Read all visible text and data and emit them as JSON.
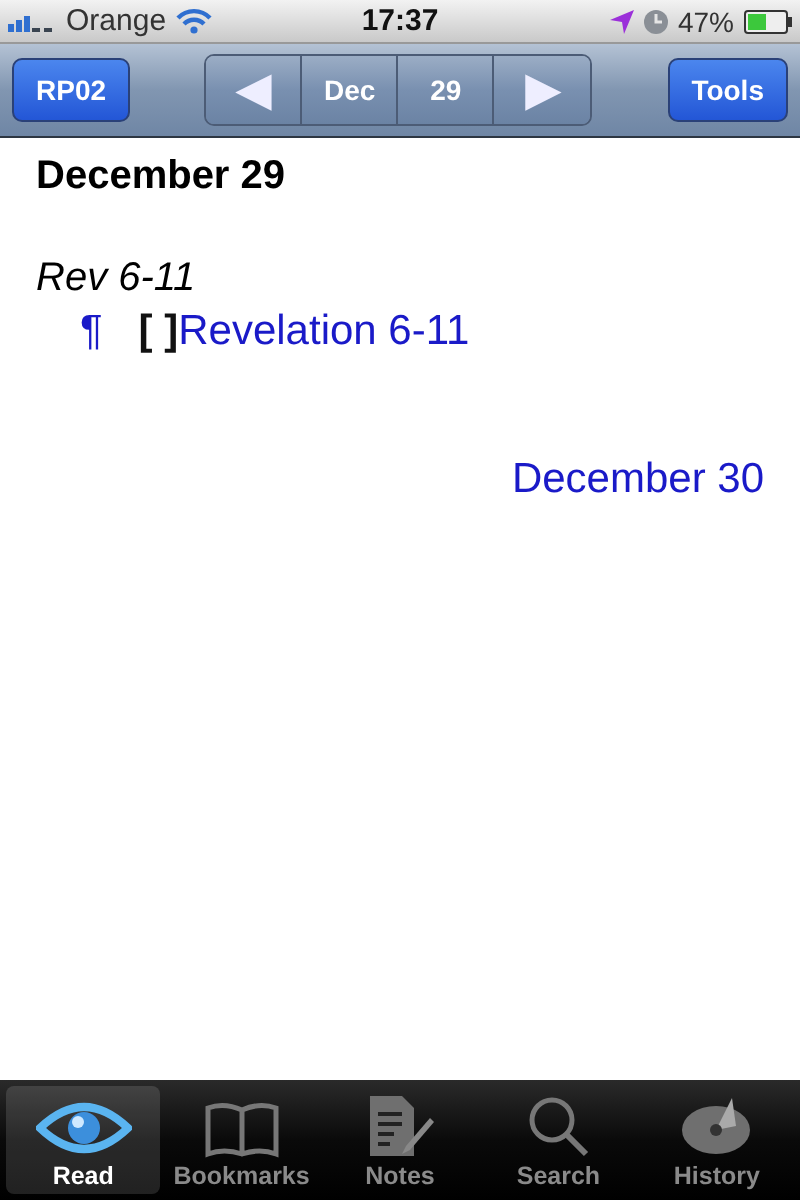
{
  "status_bar": {
    "carrier": "Orange",
    "time": "17:37",
    "battery": "47%"
  },
  "nav_bar": {
    "left_button": "RP02",
    "month": "Dec",
    "day": "29",
    "right_button": "Tools",
    "prev": "◀",
    "next": "▶"
  },
  "content": {
    "heading": "December 29",
    "passage": "Rev 6-11",
    "readings": [
      {
        "pilcrow": "¶",
        "checkbox": "[ ]",
        "checked": false,
        "link": "Revelation 6-11"
      }
    ],
    "next_link": "December 30"
  },
  "tab_bar": [
    {
      "label": "Read",
      "kind": "eye",
      "selected": true
    },
    {
      "label": "Bookmarks",
      "kind": "book",
      "selected": false
    },
    {
      "label": "Notes",
      "kind": "notes",
      "selected": false
    },
    {
      "label": "Search",
      "kind": "search",
      "selected": false
    },
    {
      "label": "History",
      "kind": "history",
      "selected": false
    }
  ]
}
